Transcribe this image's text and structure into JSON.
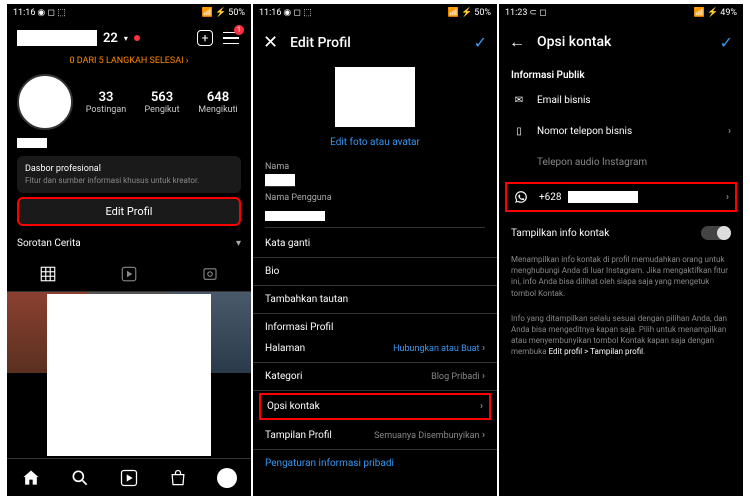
{
  "status": {
    "time1": "11:16",
    "time3": "11:23",
    "battery1": "50%",
    "battery3": "49%"
  },
  "profile": {
    "name_suffix": "22",
    "menu_badge": "1",
    "progress": "0 DARI 5 LANGKAH SELESAI ›",
    "stats": [
      {
        "num": "33",
        "label": "Postingan"
      },
      {
        "num": "563",
        "label": "Pengikut"
      },
      {
        "num": "648",
        "label": "Mengikuti"
      }
    ],
    "dashboard_title": "Dasbor profesional",
    "dashboard_sub": "Fitur dan sumber informasi khusus untuk kreator.",
    "edit_label": "Edit Profil",
    "highlights_label": "Sorotan Cerita"
  },
  "edit": {
    "title": "Edit Profil",
    "photo_link": "Edit foto atau avatar",
    "fields": {
      "nama": "Nama",
      "username": "Nama Pengguna",
      "pronoun": "Kata ganti",
      "bio": "Bio",
      "link": "Tambahkan tautan",
      "info": "Informasi Profil",
      "halaman": "Halaman",
      "halaman_val": "Hubungkan atau Buat",
      "kategori": "Kategori",
      "kategori_val": "Blog Pribadi",
      "opsi": "Opsi kontak",
      "tampilan": "Tampilan Profil",
      "tampilan_val": "Semuanya Disembunyikan",
      "privacy": "Pengaturan informasi pribadi"
    }
  },
  "opsi": {
    "title": "Opsi kontak",
    "section": "Informasi Publik",
    "email": "Email bisnis",
    "phone": "Nomor telepon bisnis",
    "audio": "Telepon audio Instagram",
    "wa_prefix": "+628",
    "show_label": "Tampilkan info kontak",
    "desc1": "Menampilkan info kontak di profil memudahkan orang untuk menghubungi Anda di luar Instagram. Jika mengaktifkan fitur ini, info Anda bisa dilihat oleh siapa saja yang mengetuk tombol Kontak.",
    "desc2a": "Info yang ditampilkan selalu sesuai dengan pilihan Anda, dan Anda bisa mengeditnya kapan saja. Pilih untuk menampilkan atau menyembunyikan tombol Kontak kapan saja dengan membuka ",
    "desc2b": "Edit profil > Tampilan profil"
  }
}
